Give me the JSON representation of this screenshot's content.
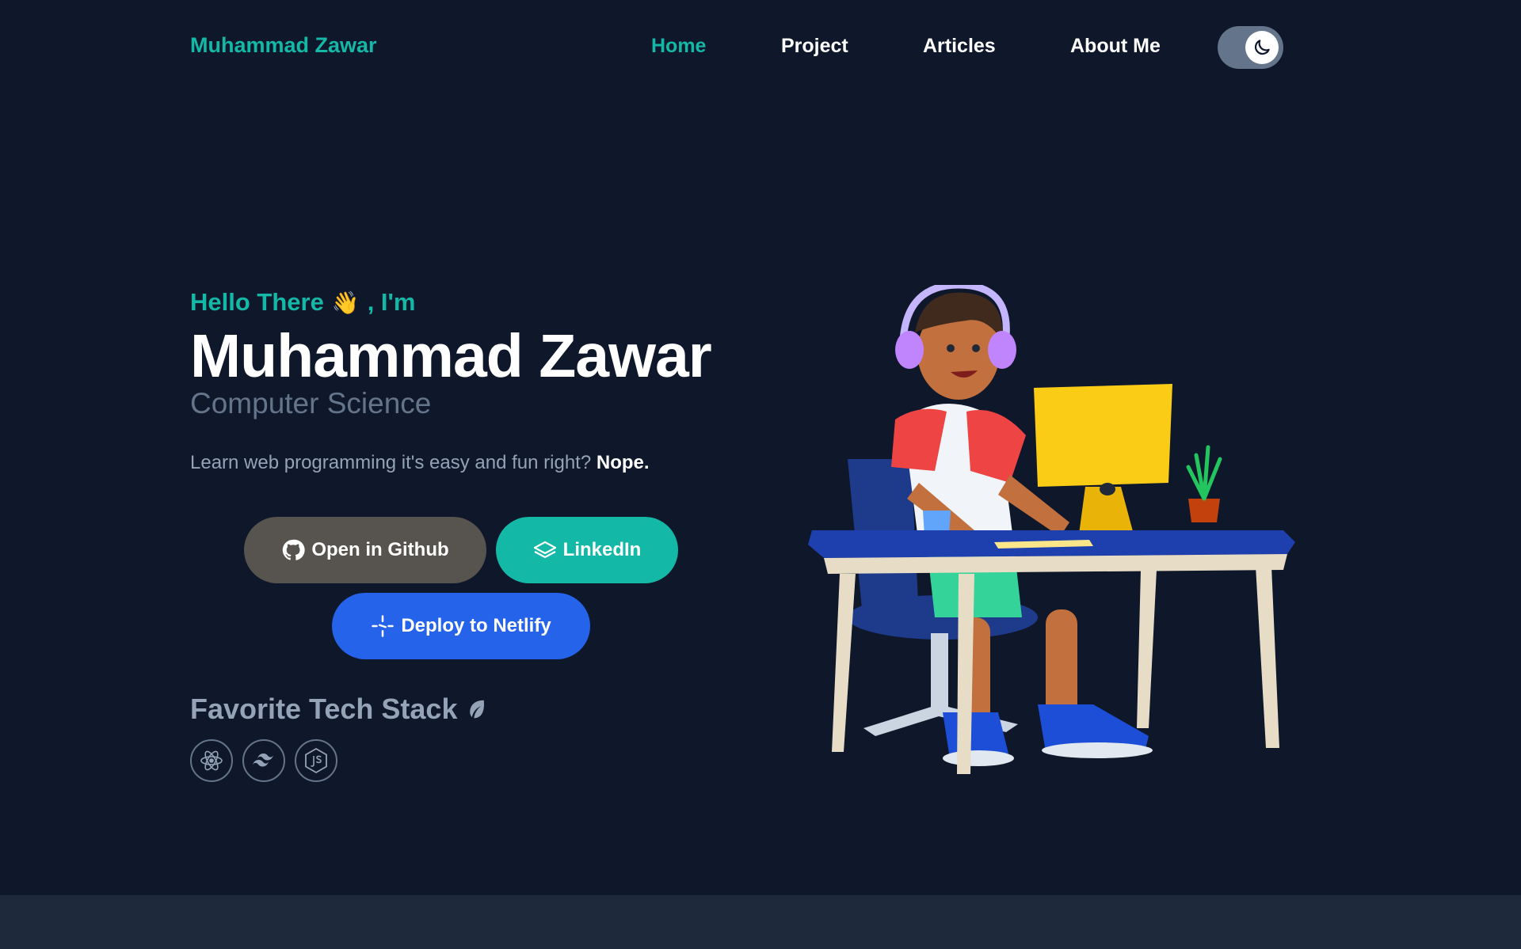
{
  "brand": "Muhammad Zawar",
  "nav": {
    "items": [
      {
        "label": "Home",
        "active": true
      },
      {
        "label": "Project",
        "active": false
      },
      {
        "label": "Articles",
        "active": false
      },
      {
        "label": "About Me",
        "active": false
      }
    ],
    "theme_toggle_icon": "moon-icon"
  },
  "hero": {
    "greeting": "Hello There",
    "greeting_emoji": "👋",
    "greeting_suffix": ", I'm",
    "name": "Muhammad Zawar",
    "subtitle": "Computer Science",
    "tagline": "Learn web programming it's easy and fun right?",
    "tagline_emphasis": "Nope."
  },
  "buttons": {
    "github": {
      "label": "Open in Github",
      "icon": "github-icon"
    },
    "linkedin": {
      "label": "LinkedIn",
      "icon": "linkedin-icon"
    },
    "netlify": {
      "label": "Deploy to Netlify",
      "icon": "netlify-icon"
    }
  },
  "tech_stack": {
    "title": "Favorite Tech Stack",
    "title_icon": "leaf-icon",
    "icons": [
      "react-icon",
      "tailwind-icon",
      "nodejs-icon"
    ]
  },
  "colors": {
    "background": "#0f172a",
    "accent": "#14b8a6",
    "github_button": "#57534e",
    "netlify_button": "#2563eb",
    "muted_text": "#64748b"
  }
}
